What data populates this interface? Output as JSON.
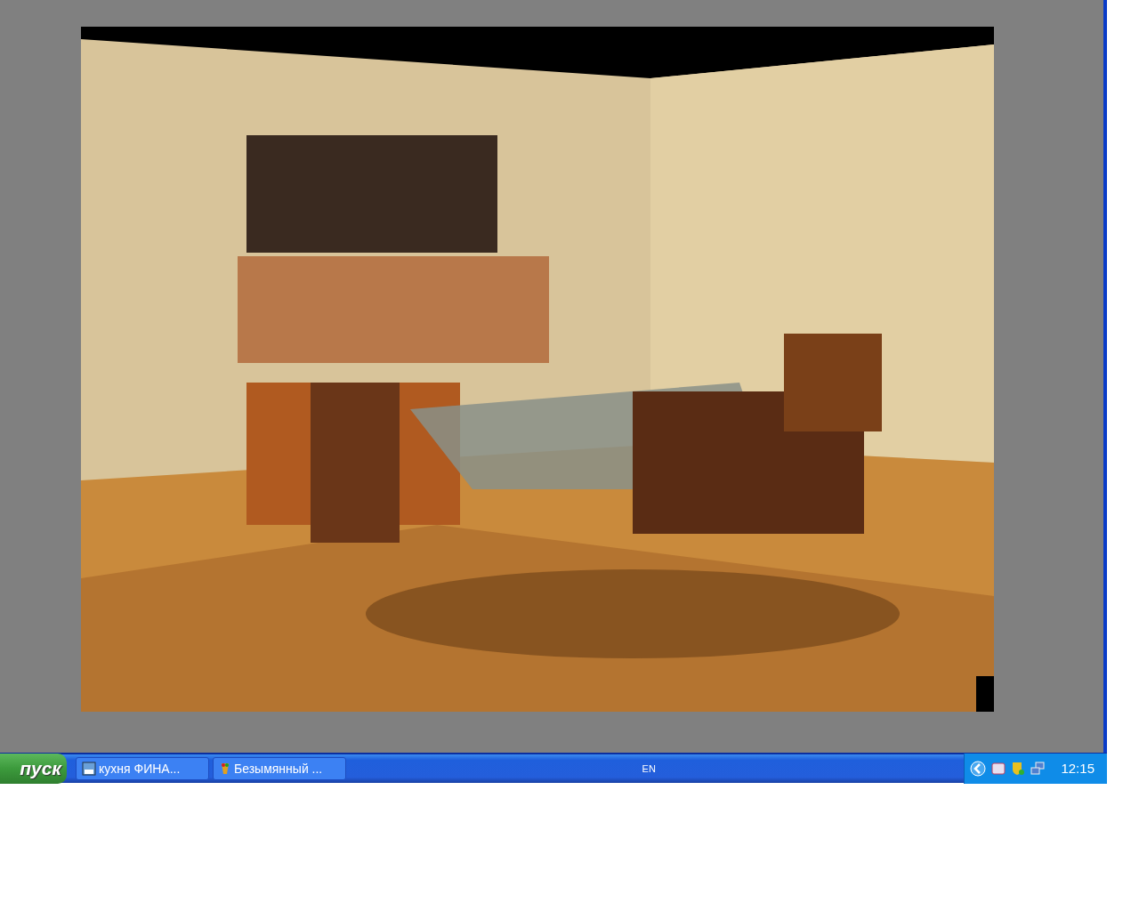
{
  "taskbar": {
    "start_label": "пуск",
    "tasks": [
      {
        "label": "кухня ФИНА...",
        "kind": "max"
      },
      {
        "label": "Безымянный ...",
        "kind": "paint"
      }
    ],
    "language": "EN",
    "clock": "12:15"
  }
}
